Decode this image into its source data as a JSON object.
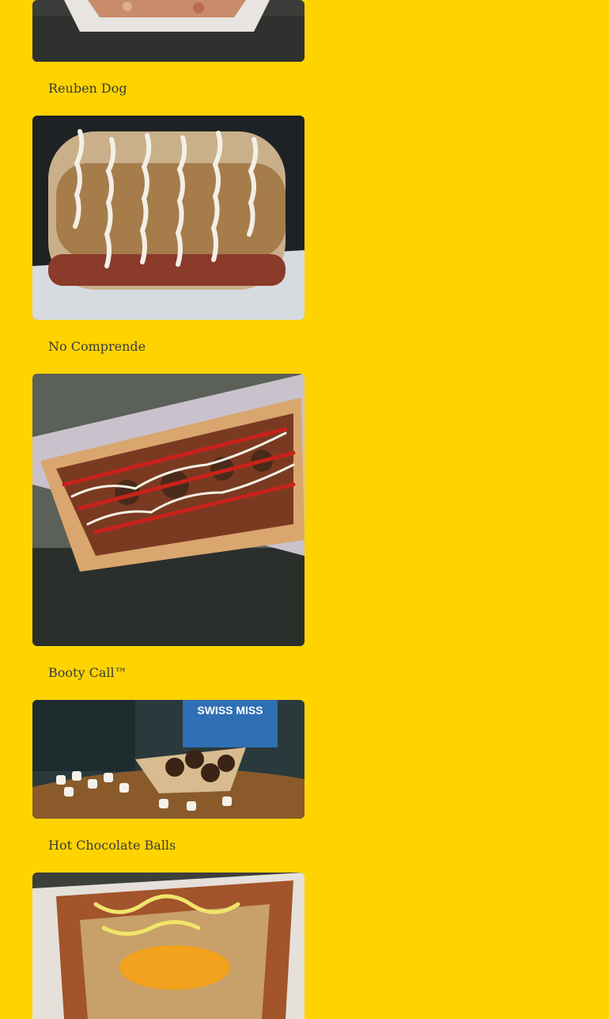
{
  "menu_items": [
    {
      "name": "Reuben Dog",
      "image": "hot-dog-photo"
    },
    {
      "name": "No Comprende",
      "image": "hot-dog-photo"
    },
    {
      "name": "Booty Call™",
      "image": "hot-dog-photo"
    },
    {
      "name": "Hot Chocolate Balls",
      "image": "dessert-photo"
    },
    {
      "name": "",
      "image": "hot-dog-photo"
    }
  ],
  "packaging_text": "SWISS MISS",
  "colors": {
    "page_background": "#ffd300",
    "caption_text": "#3a3a3a"
  }
}
